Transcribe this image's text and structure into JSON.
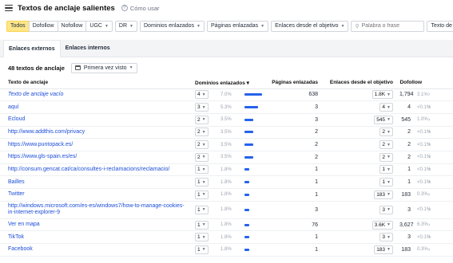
{
  "header": {
    "title": "Textos de anclaje salientes",
    "help_label": "Cómo usar"
  },
  "filters": {
    "link_types": [
      "Todos",
      "Dofollow",
      "Nofollow",
      "UGC"
    ],
    "dr_label": "DR",
    "domains_label": "Dominios enlazados",
    "pages_label": "Páginas enlazadas",
    "links_from_target_label": "Enlaces desde el objetivo",
    "search_placeholder": "Palabra o frase",
    "anchor_filter_label": "Texto de ancla"
  },
  "tabs": [
    "Enlaces externos",
    "Enlaces internos"
  ],
  "summary": {
    "count": "48 textos de anclaje",
    "date_filter": "Primera vez visto"
  },
  "columns": {
    "anchor": "Texto de anclaje",
    "domains": "Dominios enlazados",
    "pages": "Páginas enlazadas",
    "links_from_target": "Enlaces desde el objetivo",
    "dofollow": "Dofollow"
  },
  "rows": [
    {
      "anchor": "Texto de anclaje vacío",
      "italic": true,
      "domains": "4",
      "domains_pct": "7.0%",
      "bar": 1.0,
      "pages": "638",
      "links": "1.8K",
      "dofollow": "1,794",
      "dofollow_pct": "3.1%"
    },
    {
      "anchor": "aquí",
      "italic": false,
      "domains": "3",
      "domains_pct": "5.3%",
      "bar": 0.75,
      "pages": "3",
      "links": "4",
      "dofollow": "4",
      "dofollow_pct": "<0.1%"
    },
    {
      "anchor": "Ecloud",
      "italic": false,
      "domains": "2",
      "domains_pct": "3.5%",
      "bar": 0.5,
      "pages": "3",
      "links": "545",
      "dofollow": "545",
      "dofollow_pct": "1.0%"
    },
    {
      "anchor": "http://www.addthis.com/privacy",
      "italic": false,
      "domains": "2",
      "domains_pct": "3.5%",
      "bar": 0.5,
      "pages": "2",
      "links": "2",
      "dofollow": "2",
      "dofollow_pct": "<0.1%"
    },
    {
      "anchor": "https://www.puntopack.es/",
      "italic": false,
      "domains": "2",
      "domains_pct": "3.5%",
      "bar": 0.5,
      "pages": "2",
      "links": "2",
      "dofollow": "2",
      "dofollow_pct": "<0.1%"
    },
    {
      "anchor": "https://www.gls-spain.es/es/",
      "italic": false,
      "domains": "2",
      "domains_pct": "3.5%",
      "bar": 0.5,
      "pages": "2",
      "links": "2",
      "dofollow": "2",
      "dofollow_pct": "<0.1%"
    },
    {
      "anchor": "http://consum.gencat.cat/ca/consultes-i-reclamacions/reclamacio/",
      "italic": false,
      "domains": "1",
      "domains_pct": "1.8%",
      "bar": 0.25,
      "pages": "1",
      "links": "1",
      "dofollow": "1",
      "dofollow_pct": "<0.1%"
    },
    {
      "anchor": "Bailles",
      "italic": false,
      "domains": "1",
      "domains_pct": "1.8%",
      "bar": 0.25,
      "pages": "1",
      "links": "1",
      "dofollow": "1",
      "dofollow_pct": "<0.1%"
    },
    {
      "anchor": "Twitter",
      "italic": false,
      "domains": "1",
      "domains_pct": "1.8%",
      "bar": 0.25,
      "pages": "1",
      "links": "183",
      "dofollow": "183",
      "dofollow_pct": "0.3%"
    },
    {
      "anchor": "http://windows.microsoft.com/es-es/windows7/how-to-manage-cookies-in-internet-explorer-9",
      "italic": false,
      "tall": true,
      "domains": "1",
      "domains_pct": "1.8%",
      "bar": 0.25,
      "pages": "3",
      "links": "3",
      "dofollow": "3",
      "dofollow_pct": "<0.1%"
    },
    {
      "anchor": "Ver en mapa",
      "italic": false,
      "domains": "1",
      "domains_pct": "1.8%",
      "bar": 0.25,
      "pages": "76",
      "links": "3.6K",
      "dofollow": "3,627",
      "dofollow_pct": "6.3%"
    },
    {
      "anchor": "TikTok",
      "italic": false,
      "domains": "1",
      "domains_pct": "1.8%",
      "bar": 0.25,
      "pages": "1",
      "links": "3",
      "dofollow": "3",
      "dofollow_pct": "<0.1%"
    },
    {
      "anchor": "Facebook",
      "italic": false,
      "domains": "1",
      "domains_pct": "1.8%",
      "bar": 0.25,
      "pages": "1",
      "links": "183",
      "dofollow": "183",
      "dofollow_pct": "0.3%"
    }
  ],
  "icons": {
    "menu": "menu-icon",
    "help": "help-icon",
    "search": "search-icon",
    "calendar": "calendar-icon"
  },
  "colors": {
    "active_filter": "#fde68a",
    "bar": "#2563eb",
    "link": "#1d4ed8"
  }
}
